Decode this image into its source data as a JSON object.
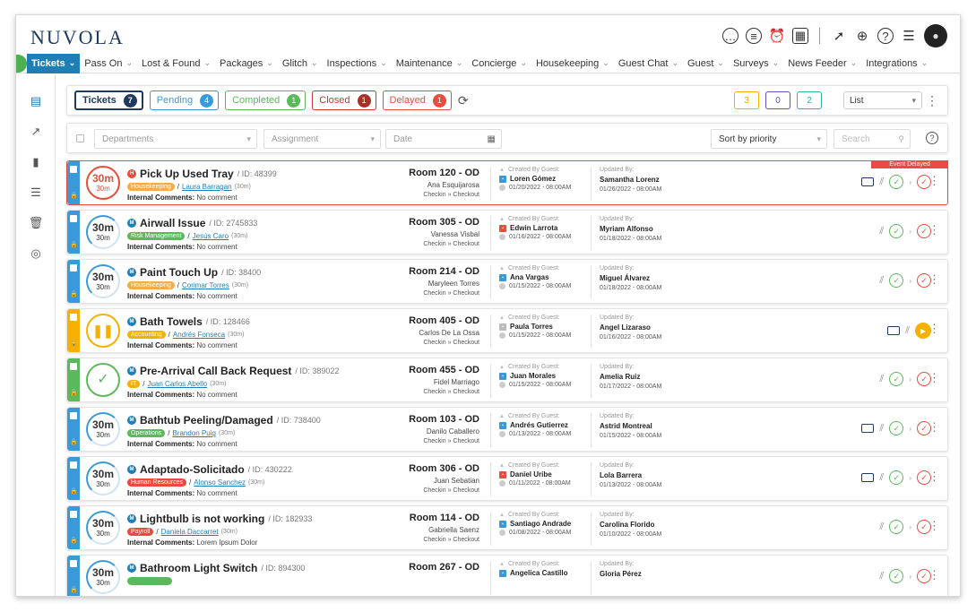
{
  "app": {
    "logo": "NUVOLA"
  },
  "nav": [
    {
      "label": "Tickets",
      "active": true
    },
    {
      "label": "Pass On"
    },
    {
      "label": "Lost & Found"
    },
    {
      "label": "Packages"
    },
    {
      "label": "Glitch"
    },
    {
      "label": "Inspections"
    },
    {
      "label": "Maintenance"
    },
    {
      "label": "Concierge"
    },
    {
      "label": "Housekeeping"
    },
    {
      "label": "Guest Chat"
    },
    {
      "label": "Guest"
    },
    {
      "label": "Surveys"
    },
    {
      "label": "News Feeder"
    },
    {
      "label": "Integrations"
    }
  ],
  "status_tabs": [
    {
      "label": "Tickets",
      "count": "7"
    },
    {
      "label": "Pending",
      "count": "4"
    },
    {
      "label": "Completed",
      "count": "1"
    },
    {
      "label": "Closed",
      "count": "1"
    },
    {
      "label": "Delayed",
      "count": "1"
    }
  ],
  "counters": {
    "yellow": "3",
    "purple": "0",
    "teal": "2",
    "colors": {
      "yellow": "#f5b000",
      "purple": "#5b4ec7",
      "teal": "#2bb5a5"
    }
  },
  "view_select": {
    "value": "List"
  },
  "filters": {
    "departments_placeholder": "Departments",
    "assignment_placeholder": "Assignment",
    "date_placeholder": "Date",
    "sort_value": "Sort by priority",
    "search_placeholder": "Search"
  },
  "labels": {
    "internal_comments": "Internal Comments:",
    "created_by_guest": "Created By Guest:",
    "updated_by": "Updated By:",
    "checkin_checkout": "Checkin  »  Checkout",
    "event_delayed": "Event Delayed",
    "time_big": "30m",
    "time_small": "30m"
  },
  "tickets": [
    {
      "title": "Pick Up Used Tray",
      "id": "/ ID: 48399",
      "priority": "H",
      "dept": "Housekeeping",
      "dept_color": "#f0ad4e",
      "assignee": "Laura Barragan",
      "dur": "(30m)",
      "comment": "No comment",
      "room": "Room 120 - OD",
      "guest": "Ana Esquijarosa",
      "creator": "Loren Gómez",
      "creator_color": "#3a9ad9",
      "created": "01/20/2022 - 08:00AM",
      "updater": "Samantha Lorenz",
      "updated": "01/26/2022 - 08:00AM",
      "strip": "#3a9ad9",
      "state": "delayed"
    },
    {
      "title": "Airwall Issue",
      "id": "/ ID: 2745833",
      "priority": "M",
      "dept": "Risk Management",
      "dept_color": "#5cb85c",
      "assignee": "Jesús Caro",
      "dur": "(30m)",
      "comment": "No comment",
      "room": "Room 305 - OD",
      "guest": "Vanessa Visbal",
      "creator": "Edwin Larrota",
      "creator_color": "#e74c3c",
      "created": "01/16/2022 - 08:00AM",
      "updater": "Myriam Alfonso",
      "updated": "01/18/2022 - 08:00AM",
      "strip": "#3a9ad9",
      "state": "timer"
    },
    {
      "title": "Paint Touch Up",
      "id": "/ ID: 38400",
      "priority": "M",
      "dept": "Housekeeping",
      "dept_color": "#f0ad4e",
      "assignee": "Corimar Torres",
      "dur": "(30m)",
      "comment": "No comment",
      "room": "Room 214 - OD",
      "guest": "Maryleen Torres",
      "creator": "Ana Vargas",
      "creator_color": "#3a9ad9",
      "created": "01/15/2022 - 08:00AM",
      "updater": "Miguel Álvarez",
      "updated": "01/18/2022 - 08:00AM",
      "strip": "#3a9ad9",
      "state": "timer"
    },
    {
      "title": "Bath Towels",
      "id": "/ ID: 128466",
      "priority": "M",
      "dept": "Accounting",
      "dept_color": "#f5b000",
      "assignee": "Andrés Fonseca",
      "dur": "(30m)",
      "comment": "No comment",
      "room": "Room 405 - OD",
      "guest": "Carlos De La Ossa",
      "creator": "Paula Torres",
      "creator_color": "#bbbbbb",
      "created": "01/15/2022 - 08:00AM",
      "updater": "Angel Lizaraso",
      "updated": "01/16/2022 - 08:00AM",
      "strip": "#f5b000",
      "state": "paused"
    },
    {
      "title": "Pre-Arrival Call Back Request",
      "id": "/ ID: 389022",
      "priority": "M",
      "dept": "IT",
      "dept_color": "#f5b000",
      "assignee": "Juan Carlos Abello",
      "dur": "(30m)",
      "comment": "No comment",
      "room": "Room 455 - OD",
      "guest": "Fidel Marriago",
      "creator": "Juan Morales",
      "creator_color": "#3a9ad9",
      "created": "01/15/2022 - 08:00AM",
      "updater": "Amelia Ruiz",
      "updated": "01/17/2022 - 08:00AM",
      "strip": "#5cb85c",
      "state": "done"
    },
    {
      "title": "Bathtub Peeling/Damaged",
      "id": "/ ID: 738400",
      "priority": "M",
      "dept": "Operations",
      "dept_color": "#5cb85c",
      "assignee": "Brandon Puig",
      "dur": "(30m)",
      "comment": "No comment",
      "room": "Room 103 - OD",
      "guest": "Danilo Caballero",
      "creator": "Andrés Gutierrez",
      "creator_color": "#3a9ad9",
      "created": "01/13/2022 - 08:00AM",
      "updater": "Astrid Montreal",
      "updated": "01/15/2022 - 08:00AM",
      "strip": "#3a9ad9",
      "state": "timer"
    },
    {
      "title": "Adaptado-Solicitado",
      "id": "/ ID: 430222",
      "priority": "M",
      "dept": "Human Resources",
      "dept_color": "#e74c3c",
      "assignee": "Alonso Sanchez",
      "dur": "(30m)",
      "comment": "No comment",
      "room": "Room 306 - OD",
      "guest": "Juan Sebatian",
      "creator": "Daniel Uribe",
      "creator_color": "#e74c3c",
      "created": "01/11/2022 - 08:00AM",
      "updater": "Lola Barrera",
      "updated": "01/13/2022 - 08:00AM",
      "strip": "#3a9ad9",
      "state": "timer"
    },
    {
      "title": "Lightbulb is not working",
      "id": "/ ID: 182933",
      "priority": "M",
      "dept": "Payroll",
      "dept_color": "#e74c3c",
      "assignee": "Daniela Daccarret",
      "dur": "(30m)",
      "comment": "Lorem Ipsum Dolor",
      "room": "Room 114 - OD",
      "guest": "Gabriella Saenz",
      "creator": "Santiago Andrade",
      "creator_color": "#3a9ad9",
      "created": "01/08/2022 - 08:00AM",
      "updater": "Carolina Florido",
      "updated": "01/10/2022 - 08:00AM",
      "strip": "#3a9ad9",
      "state": "timer"
    },
    {
      "title": "Bathroom Light Switch",
      "id": "/ ID: 894300",
      "priority": "M",
      "dept": "",
      "dept_color": "#5cb85c",
      "assignee": "",
      "dur": "",
      "comment": "",
      "room": "Room 267 - OD",
      "guest": "",
      "creator": "Angelica Castillo",
      "creator_color": "#3a9ad9",
      "created": "",
      "updater": "Gloria Pérez",
      "updated": "",
      "strip": "#3a9ad9",
      "state": "timer"
    }
  ]
}
